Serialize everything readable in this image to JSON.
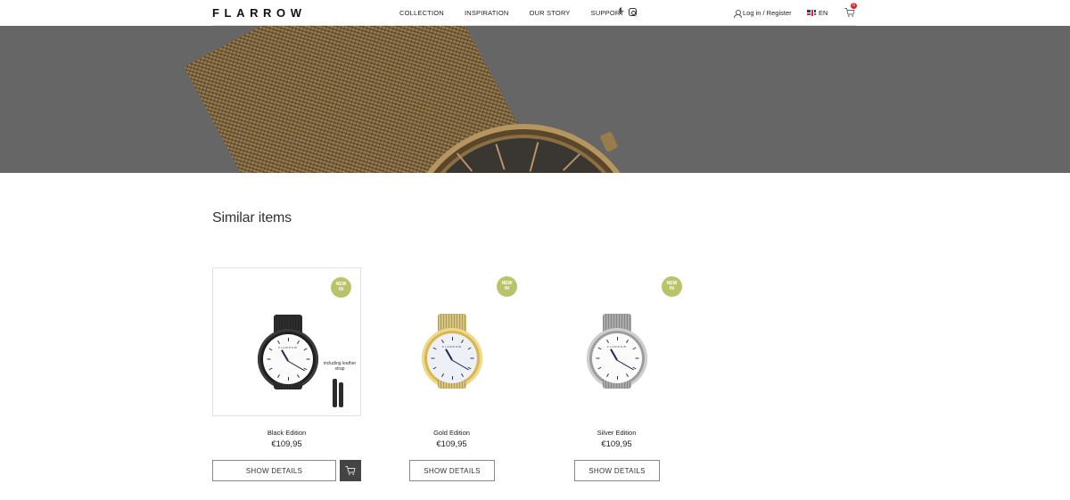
{
  "header": {
    "logo": "FLARROW",
    "nav": [
      "COLLECTION",
      "INSPIRATION",
      "OUR STORY",
      "SUPPORT"
    ],
    "social": {
      "facebook": "f",
      "instagram_icon": "instagram-icon"
    },
    "login": "Log in / Register",
    "language": "EN",
    "cart_count": "0"
  },
  "colors": {
    "badge": "#b9c46a",
    "hero_bg": "#666666",
    "cart_badge": "#e0202a",
    "cart_button": "#444444"
  },
  "section": {
    "title": "Similar items"
  },
  "products": [
    {
      "name": "Black Edition",
      "price": "€109,95",
      "badge": "NEW IN",
      "note": "including leather strap",
      "button": "SHOW DETAILS"
    },
    {
      "name": "Gold Edition",
      "price": "€109,95",
      "badge": "NEW IN",
      "button": "SHOW DETAILS"
    },
    {
      "name": "Silver Edition",
      "price": "€109,95",
      "badge": "NEW IN",
      "button": "SHOW DETAILS"
    }
  ]
}
